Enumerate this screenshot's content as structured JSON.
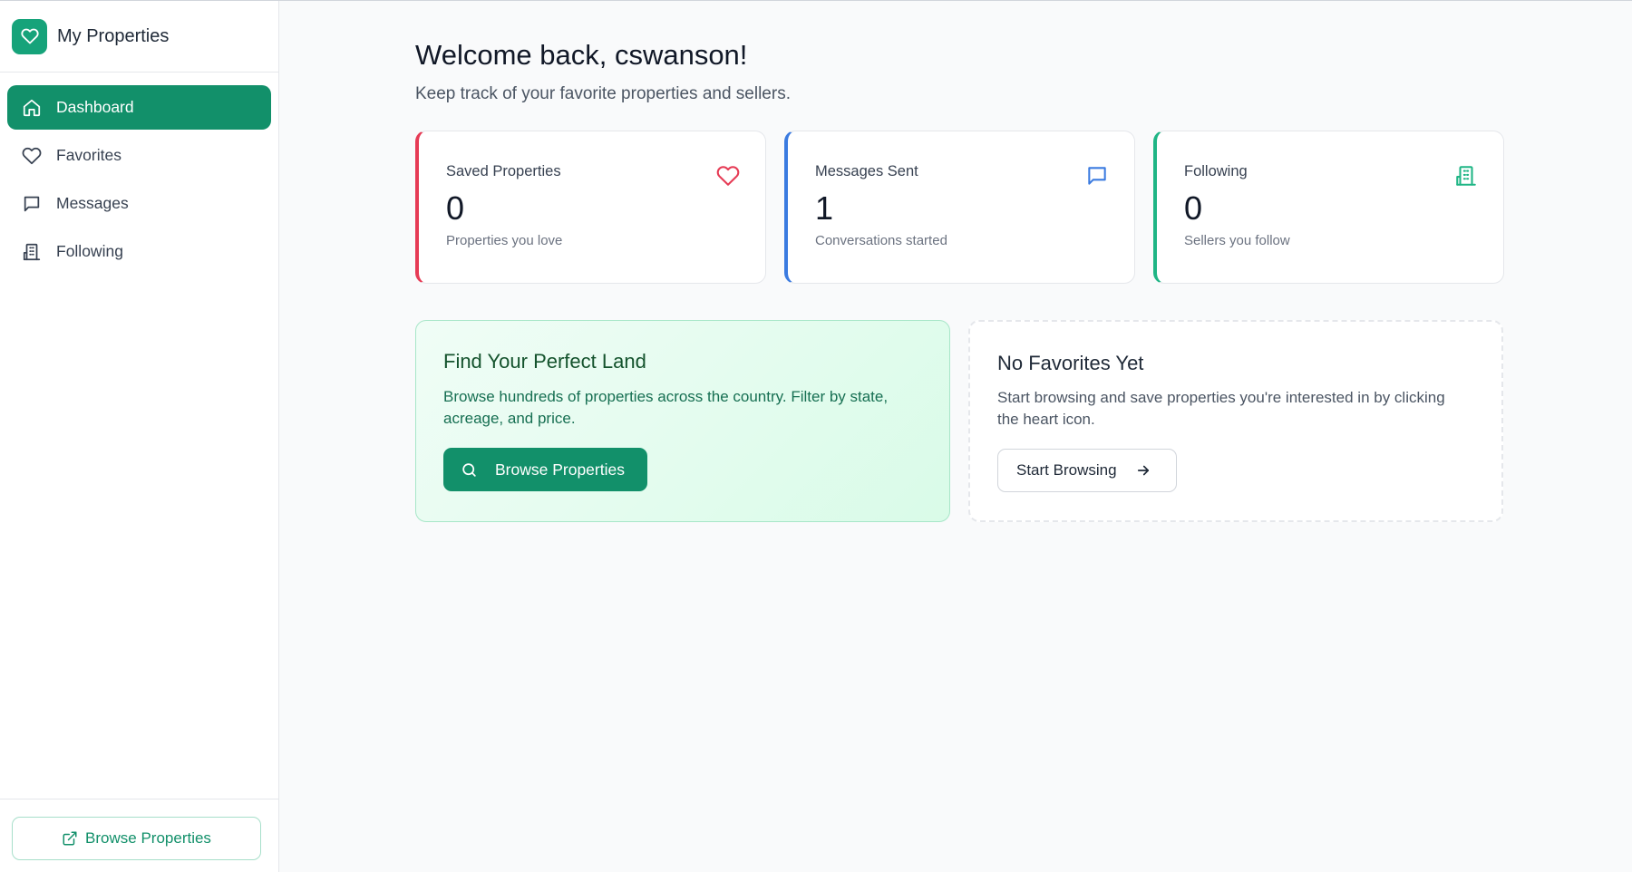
{
  "sidebar": {
    "brand": {
      "title": "My Properties",
      "icon": "heart-icon",
      "color": "#16a37a"
    },
    "items": [
      {
        "label": "Dashboard",
        "icon": "home-icon",
        "active": true
      },
      {
        "label": "Favorites",
        "icon": "heart-icon",
        "active": false
      },
      {
        "label": "Messages",
        "icon": "message-icon",
        "active": false
      },
      {
        "label": "Following",
        "icon": "building-icon",
        "active": false
      }
    ],
    "footer_button": {
      "label": "Browse Properties",
      "icon": "external-link-icon"
    }
  },
  "main": {
    "welcome": "Welcome back, cswanson!",
    "subtitle": "Keep track of your favorite properties and sellers.",
    "stats": [
      {
        "label": "Saved Properties",
        "value": "0",
        "description": "Properties you love",
        "icon": "heart-icon",
        "color": "#e63b55"
      },
      {
        "label": "Messages Sent",
        "value": "1",
        "description": "Conversations started",
        "icon": "message-icon",
        "color": "#3b7be0"
      },
      {
        "label": "Following",
        "value": "0",
        "description": "Sellers you follow",
        "icon": "building-icon",
        "color": "#1fb585"
      }
    ],
    "promo": {
      "title": "Find Your Perfect Land",
      "text": "Browse hundreds of properties across the country. Filter by state, acreage, and price.",
      "button_label": "Browse Properties",
      "button_icon": "search-icon"
    },
    "empty_state": {
      "title": "No Favorites Yet",
      "text": "Start browsing and save properties you're interested in by clicking the heart icon.",
      "button_label": "Start Browsing",
      "button_icon": "arrow-right-icon"
    }
  }
}
